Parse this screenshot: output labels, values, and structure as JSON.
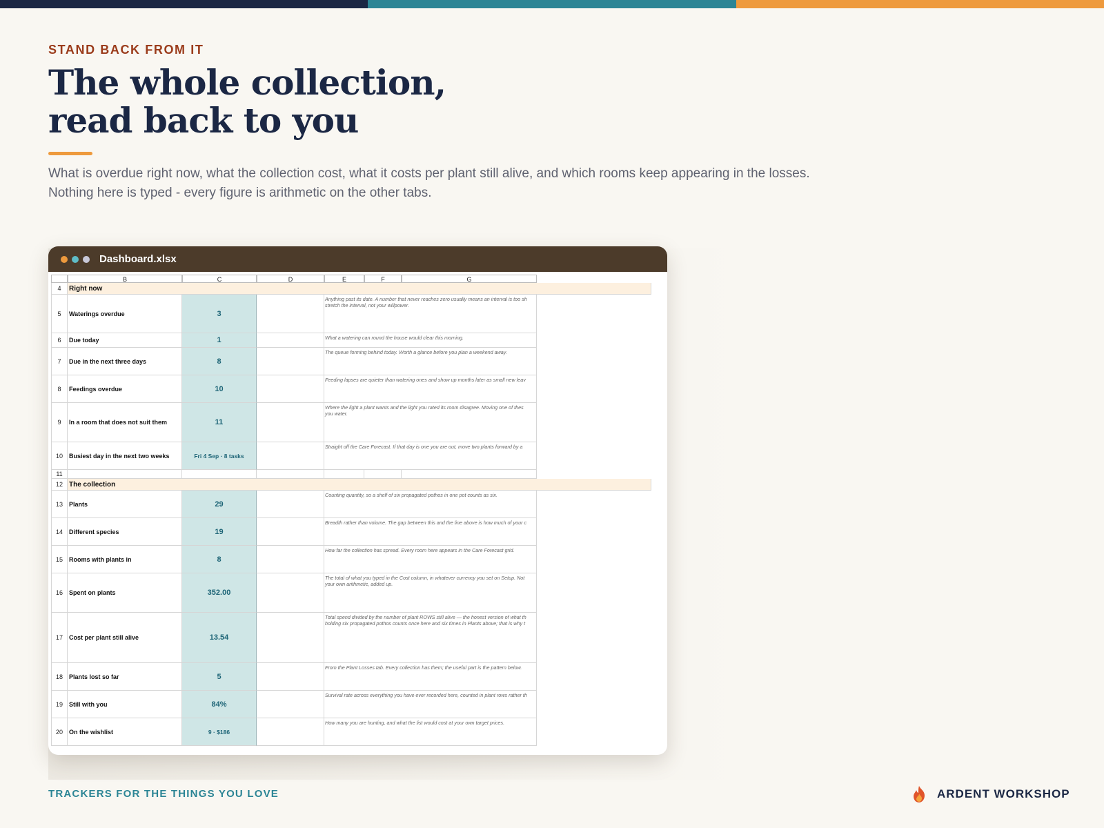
{
  "colors": {
    "navy": "#1b2744",
    "teal": "#2c8595",
    "orange": "#ee9a3d",
    "rust": "#9b3c1c",
    "window_bar": "#4c3b2a",
    "value_fill": "#cfe6e6",
    "section_fill": "#fdf0df"
  },
  "header": {
    "eyebrow": "STAND BACK FROM IT",
    "title_line1": "The whole collection,",
    "title_line2": "read back to you",
    "lede_line1": "What is overdue right now, what the collection cost, what it costs per plant still alive, and which rooms keep appearing in the losses.",
    "lede_line2": "Nothing here is typed - every figure is arithmetic on the other tabs."
  },
  "window": {
    "title": "Dashboard.xlsx",
    "dots": [
      "#ee9a3d",
      "#5fbcc7",
      "#c8c8d8"
    ]
  },
  "sheet": {
    "columns": [
      "B",
      "C",
      "D",
      "E",
      "F",
      "G"
    ],
    "rows": [
      {
        "n": "4",
        "kind": "section",
        "label": "Right now"
      },
      {
        "n": "5",
        "kind": "data",
        "label": "Waterings overdue",
        "value": "3",
        "note": "Anything past its date. A number that never reaches zero usually means an interval is too sh\nstretch the interval, not your willpower."
      },
      {
        "n": "6",
        "kind": "data",
        "label": "Due today",
        "value": "1",
        "note": "What a watering can round the house would clear this morning."
      },
      {
        "n": "7",
        "kind": "data",
        "label": "Due in the next three days",
        "value": "8",
        "note": "The queue forming behind today. Worth a glance before you plan a weekend away."
      },
      {
        "n": "8",
        "kind": "data",
        "label": "Feedings overdue",
        "value": "10",
        "note": "Feeding lapses are quieter than watering ones and show up months later as small new leav"
      },
      {
        "n": "9",
        "kind": "data",
        "label": "In a room that does not suit them",
        "value": "11",
        "note": "Where the light a plant wants and the light you rated its room disagree. Moving one of thes\nyou water."
      },
      {
        "n": "10",
        "kind": "data",
        "label": "Busiest day in the next two weeks",
        "value": "Fri 4 Sep · 8 tasks",
        "small": true,
        "note": "Straight off the Care Forecast. If that day is one you are out, move two plants forward by a"
      },
      {
        "n": "11",
        "kind": "blank"
      },
      {
        "n": "12",
        "kind": "section",
        "label": "The collection"
      },
      {
        "n": "13",
        "kind": "data",
        "label": "Plants",
        "value": "29",
        "note": "Counting quantity, so a shelf of six propagated pothos in one pot counts as six."
      },
      {
        "n": "14",
        "kind": "data",
        "label": "Different species",
        "value": "19",
        "note": "Breadth rather than volume. The gap between this and the line above is how much of your c"
      },
      {
        "n": "15",
        "kind": "data",
        "label": "Rooms with plants in",
        "value": "8",
        "note": "How far the collection has spread. Every room here appears in the Care Forecast grid."
      },
      {
        "n": "16",
        "kind": "data",
        "label": "Spent on plants",
        "value": "352.00",
        "note": "The total of what you typed in the Cost column, in whatever currency you set on Setup. Not\nyour own arithmetic, added up."
      },
      {
        "n": "17",
        "kind": "data",
        "label": "Cost per plant still alive",
        "value": "13.54",
        "note": "Total spend divided by the number of plant ROWS still alive — the honest version of what th\nholding six propagated pothos counts once here and six times in Plants above; that is why t"
      },
      {
        "n": "18",
        "kind": "data",
        "label": "Plants lost so far",
        "value": "5",
        "note": "From the Plant Losses tab. Every collection has them; the useful part is the pattern below."
      },
      {
        "n": "19",
        "kind": "data",
        "label": "Still with you",
        "value": "84%",
        "note": "Survival rate across everything you have ever recorded here, counted in plant rows rather th"
      },
      {
        "n": "20",
        "kind": "data",
        "label": "On the wishlist",
        "value": "9 · $186",
        "small": true,
        "note": "How many you are hunting, and what the list would cost at your own target prices."
      }
    ]
  },
  "footer": {
    "tagline": "TRACKERS FOR THE THINGS YOU LOVE",
    "brand": "ARDENT WORKSHOP",
    "brand_icon": "flame-icon"
  }
}
